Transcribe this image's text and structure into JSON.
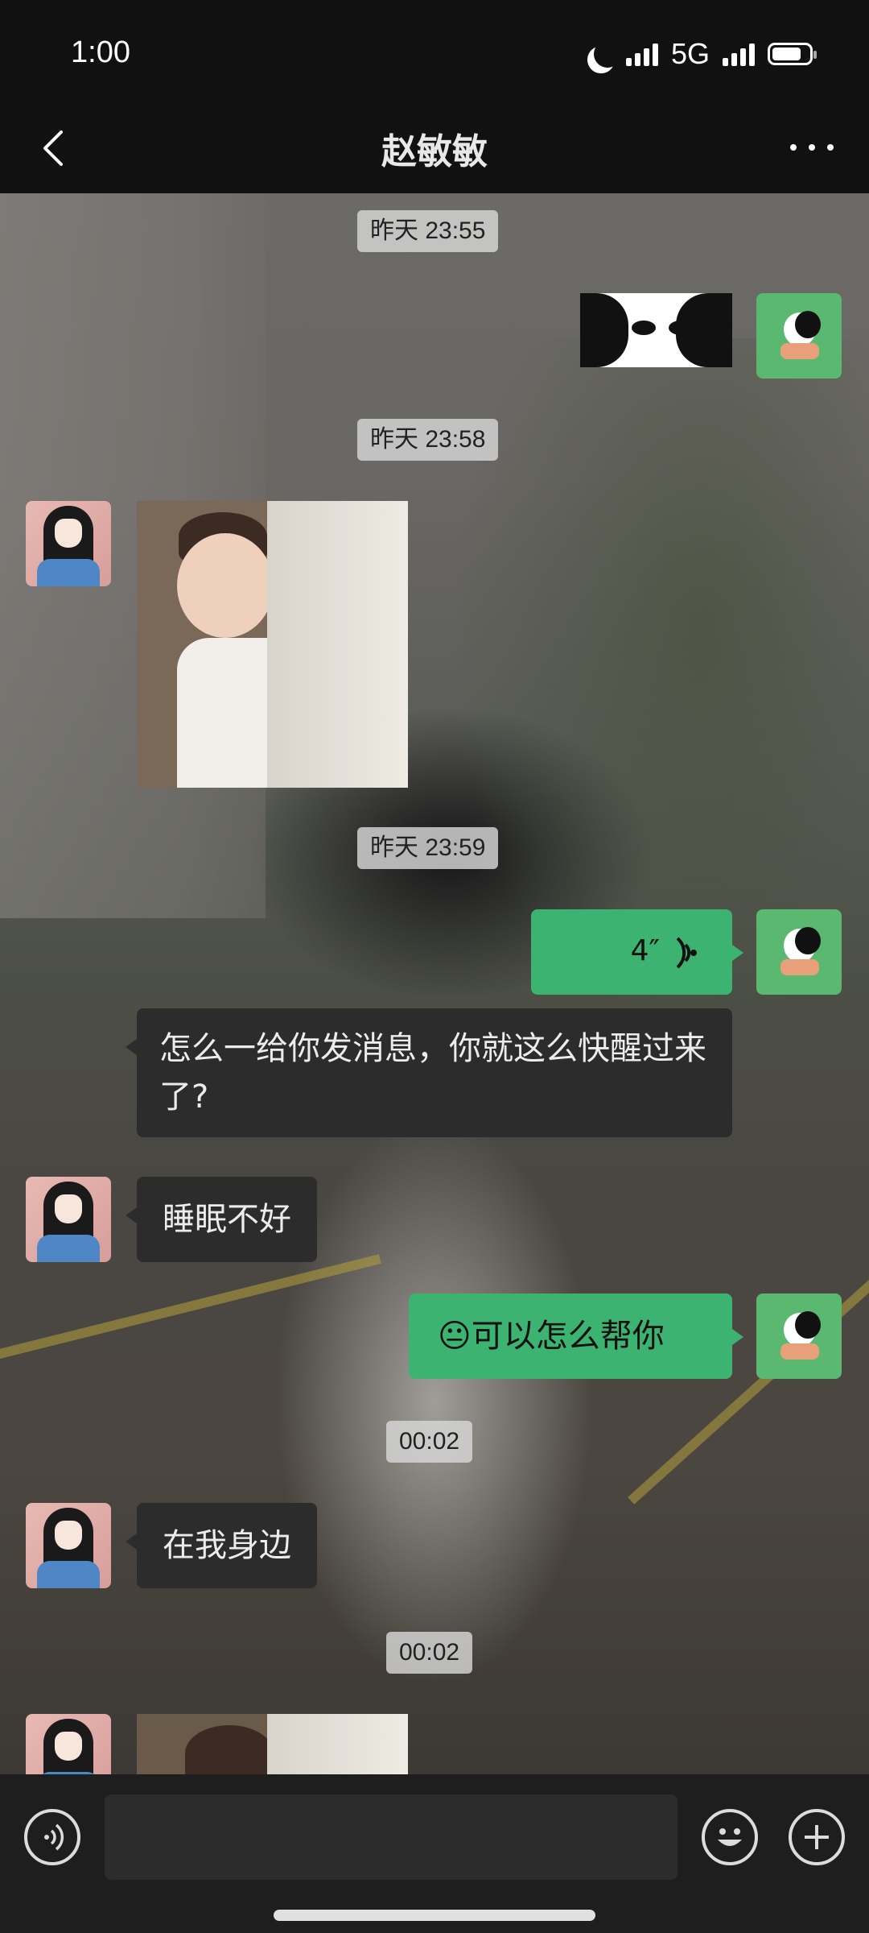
{
  "status_bar": {
    "time": "1:00",
    "network": "5G",
    "icons": [
      "moon-icon",
      "signal-icon",
      "signal-icon",
      "battery-icon"
    ],
    "battery_level": 0.8
  },
  "header": {
    "title": "赵敏敏",
    "back_icon": "chevron-left-icon",
    "more_icon": "more-dots-icon"
  },
  "messages": {
    "ts1": "昨天 23:55",
    "ts2": "昨天 23:58",
    "ts3": "昨天 23:59",
    "ts4": "00:02",
    "ts5": "00:02",
    "voice_duration": "4″",
    "text1": "怎么一给你发消息，你就这么快醒过来了?",
    "text2": "睡眠不好",
    "text3_emoji": "😐",
    "text3": "可以怎么帮你",
    "text4": "在我身边"
  },
  "input_bar": {
    "voice_icon": "voice-input-icon",
    "emoji_icon": "emoji-icon",
    "plus_icon": "plus-icon"
  },
  "colors": {
    "outgoing_bubble": "#3cb371",
    "incoming_bubble": "#2c2c2c",
    "background": "#111111"
  }
}
